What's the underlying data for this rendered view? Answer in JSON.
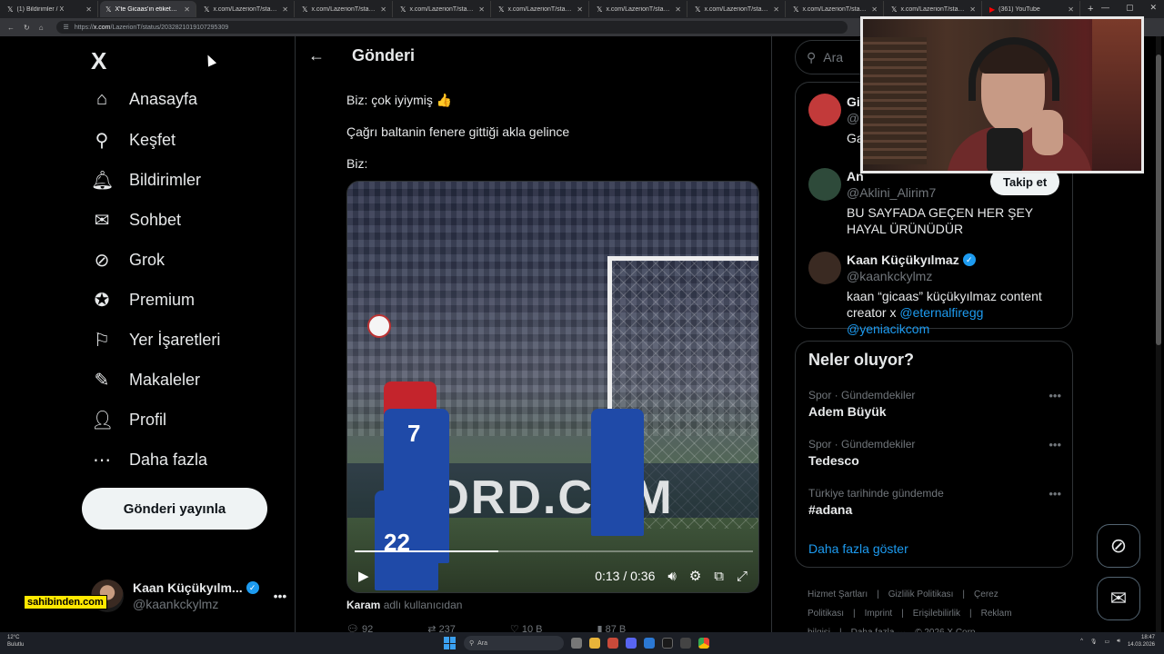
{
  "browser": {
    "tabs": [
      {
        "title": "(1) Bildirimler / X",
        "icon": "x-logo-icon",
        "active": false
      },
      {
        "title": "X'te Gicaas'ın etiketçisi: \"@A",
        "icon": "x-logo-icon",
        "active": true
      },
      {
        "title": "x.com/LazerionT/status/203",
        "icon": "x-logo-icon",
        "active": false
      },
      {
        "title": "x.com/LazerionT/status/203",
        "icon": "x-logo-icon",
        "active": false
      },
      {
        "title": "x.com/LazerionT/status/203",
        "icon": "x-logo-icon",
        "active": false
      },
      {
        "title": "x.com/LazerionT/status/203",
        "icon": "x-logo-icon",
        "active": false
      },
      {
        "title": "x.com/LazerionT/status/203",
        "icon": "x-logo-icon",
        "active": false
      },
      {
        "title": "x.com/LazerionT/status/203",
        "icon": "x-logo-icon",
        "active": false
      },
      {
        "title": "x.com/LazerionT/status/203",
        "icon": "x-logo-icon",
        "active": false
      },
      {
        "title": "x.com/LazerionT/status/203",
        "icon": "x-logo-icon",
        "active": false
      },
      {
        "title": "(361) YouTube",
        "icon": "youtube-icon",
        "active": false
      }
    ],
    "url_prefix": "https://",
    "url_domain": "x.com",
    "url_path": "/LazerionT/status/2032821019107295309"
  },
  "nav": {
    "logo": "X",
    "items": [
      {
        "label": "Anasayfa",
        "icon": "home-icon",
        "glyph": "⌂"
      },
      {
        "label": "Keşfet",
        "icon": "search-icon",
        "glyph": "⚲"
      },
      {
        "label": "Bildirimler",
        "icon": "bell-icon",
        "glyph": "🔔︎"
      },
      {
        "label": "Sohbet",
        "icon": "mail-icon",
        "glyph": "✉"
      },
      {
        "label": "Grok",
        "icon": "grok-icon",
        "glyph": "⊘"
      },
      {
        "label": "Premium",
        "icon": "premium-icon",
        "glyph": "✪"
      },
      {
        "label": "Yer İşaretleri",
        "icon": "bookmark-icon",
        "glyph": "⚐"
      },
      {
        "label": "Makaleler",
        "icon": "articles-icon",
        "glyph": "✎"
      },
      {
        "label": "Profil",
        "icon": "profile-icon",
        "glyph": "👤︎"
      },
      {
        "label": "Daha fazla",
        "icon": "more-icon",
        "glyph": "⋯"
      }
    ],
    "post_button": "Gönderi yayınla",
    "account": {
      "name": "Kaan Küçükyılm...",
      "handle": "@kaankckylmz",
      "more": "•••"
    }
  },
  "sponsor_overlay": "sahibinden.com",
  "main": {
    "back_glyph": "←",
    "title": "Gönderi",
    "lines": [
      "Biz: çok iyiymiş 👍",
      "Çağrı baltanin fenere gittiği akla gelince",
      "Biz:"
    ],
    "video": {
      "board_text": "ORD.COM",
      "current_time": "0:13",
      "duration": "0:36",
      "time_display": "0:13 / 0:36",
      "progress": 0.36,
      "jersey_numbers": [
        "7",
        "22"
      ]
    },
    "attribution_user": "Karam",
    "attribution_suffix": " adlı kullanıcıdan",
    "actions": [
      "92",
      "237",
      "10 B",
      "87 B"
    ]
  },
  "right": {
    "search_placeholder": "Ara",
    "people": [
      {
        "name": "Gi",
        "handle": "@",
        "bio": "Ga",
        "verified": false,
        "avatar_color": "#c23a3a"
      },
      {
        "name": "An",
        "handle": "@Aklini_Alirim7",
        "bio": "BU SAYFADA GEÇEN HER ŞEY HAYAL ÜRÜNÜDÜR",
        "verified": false,
        "avatar_color": "#2e4a3a"
      },
      {
        "name": "Kaan Küçükyılmaz",
        "handle": "@kaankckylmz",
        "bio_prefix": "kaan “gicaas” küçükyılmaz content creator x ",
        "bio_link1": "@eternalfiregg",
        "bio_link2": "@yeniacikcom",
        "verified": true,
        "avatar_color": "#3a2a22"
      }
    ],
    "follow_button": "Takip et",
    "trends_title": "Neler oluyor?",
    "trends": [
      {
        "category": "Spor · Gündemdekiler",
        "name": "Adem Büyük"
      },
      {
        "category": "Spor · Gündemdekiler",
        "name": "Tedesco"
      },
      {
        "category": "Türkiye tarihinde gündemde",
        "name": "#adana"
      }
    ],
    "show_more": "Daha fazla göster",
    "footer": [
      "Hizmet Şartları",
      "|",
      "Gizlilik Politikası",
      "|",
      "Çerez Politikası",
      "|",
      "Imprint",
      "|",
      "Erişilebilirlik",
      "|",
      "Reklam bilgisi",
      "|",
      "Daha fazla ···",
      "© 2026 X Corp."
    ]
  },
  "taskbar": {
    "weather_temp": "12°C",
    "weather_desc": "Bulutlu",
    "search_label": "Ara",
    "time": "18:47",
    "date": "14.03.2026"
  },
  "colors": {
    "accent": "#1d9bf0",
    "background": "#000000",
    "text": "#e7e9ea",
    "muted": "#71767b"
  }
}
